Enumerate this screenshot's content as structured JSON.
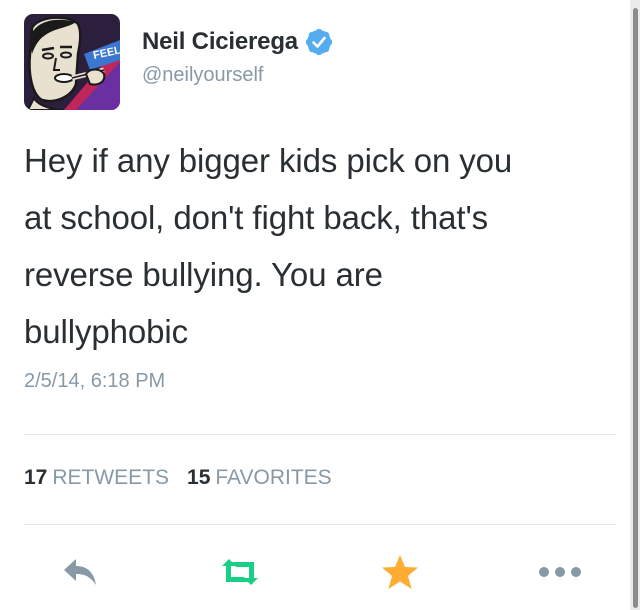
{
  "user": {
    "name": "Neil Cicierega",
    "handle": "@neilyourself",
    "verified": true,
    "avatar_badge_text": "FEEL"
  },
  "tweet": {
    "lines": [
      "Hey if any bigger kids pick on you",
      "at school, don't fight back, that's",
      "reverse bullying. You are",
      "bullyphobic"
    ],
    "timestamp": "2/5/14, 6:18 PM"
  },
  "stats": {
    "retweets_count": "17",
    "retweets_label": "RETWEETS",
    "favorites_count": "15",
    "favorites_label": "FAVORITES"
  },
  "actions": [
    {
      "name": "reply",
      "icon": "reply-icon",
      "color": "#8899a6"
    },
    {
      "name": "retweet",
      "icon": "retweet-icon",
      "color": "#19cf86"
    },
    {
      "name": "favorite",
      "icon": "star-icon",
      "color": "#ffac33"
    },
    {
      "name": "more",
      "icon": "more-icon",
      "color": "#8899a6"
    }
  ],
  "colors": {
    "text": "#292f33",
    "secondary": "#8899a6",
    "verified": "#55acee",
    "divider": "#e1e8ed"
  }
}
